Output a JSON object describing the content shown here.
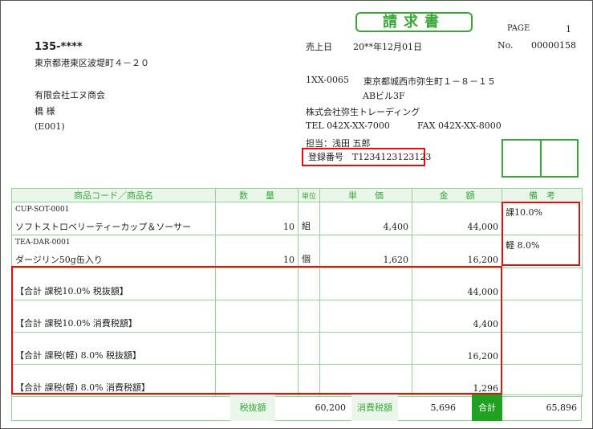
{
  "doc": {
    "title": "請求書",
    "page_label": "PAGE",
    "page_no": "1",
    "date_label": "売上日",
    "date": "20**年12月01日",
    "no_label": "No.",
    "no": "00000158"
  },
  "customer": {
    "zip": "135-****",
    "address": "東京都港東区波堤町４－２０",
    "company": "有限会社エヌ商会",
    "person": "橋 様",
    "code": "(E001)"
  },
  "issuer": {
    "zip": "1XX-0065",
    "address": "東京都城西市弥生町１－８－１５",
    "building": "ABビル3F",
    "company": "株式会社弥生トレーディング",
    "tel": "TEL 042X-XX-7000",
    "fax": "FAX 042X-XX-8000",
    "staff": "担当：浅田 五郎",
    "registration": "登録番号　T1234123123123"
  },
  "table": {
    "headers": [
      "商品コード／商品名",
      "数　　量",
      "単位",
      "単　　価",
      "金　　額",
      "備　考"
    ],
    "items": [
      {
        "code": "CUP-SOT-0001",
        "name": "ソフトストロベリーティーカップ＆ソーサー",
        "qty": "10",
        "unit": "組",
        "price": "4,400",
        "amount": "44,000",
        "note": "課10.0%"
      },
      {
        "code": "TEA-DAR-0001",
        "name": "ダージリン50g缶入り",
        "qty": "10",
        "unit": "個",
        "price": "1,620",
        "amount": "16,200",
        "note": "軽 8.0%"
      }
    ],
    "summary": [
      {
        "label": "【合計 課税10.0% 税抜額】",
        "amount": "44,000"
      },
      {
        "label": "【合計 課税10.0% 消費税額】",
        "amount": "4,400"
      },
      {
        "label": "【合計 課税(軽) 8.0% 税抜額】",
        "amount": "16,200"
      },
      {
        "label": "【合計 課税(軽) 8.0% 消費税額】",
        "amount": "1,296"
      }
    ]
  },
  "totals": {
    "pretax_label": "税抜額",
    "pretax": "60,200",
    "tax_label": "消費税額",
    "tax": "5,696",
    "total_label": "合計",
    "total": "65,896"
  },
  "colors": {
    "accent": "#3aa63a",
    "highlight": "#dd1111"
  }
}
